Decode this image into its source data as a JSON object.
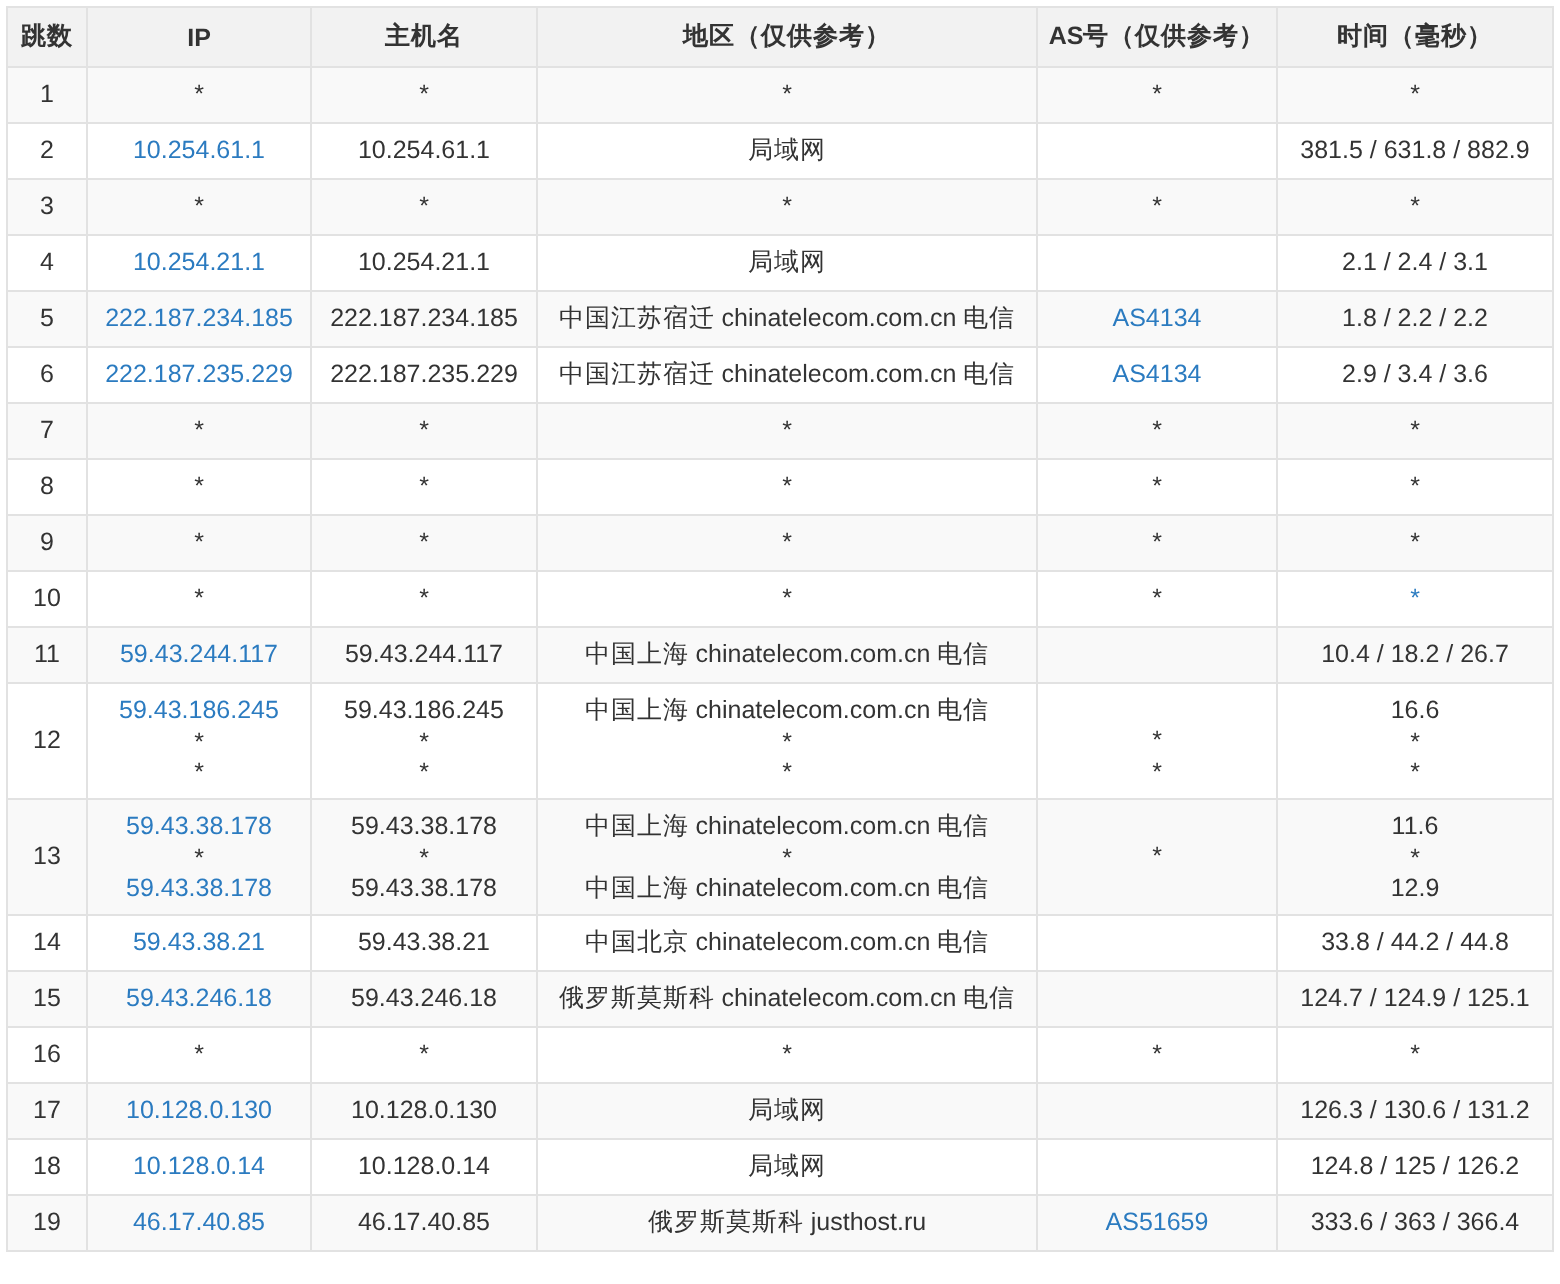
{
  "table": {
    "columns": [
      "跳数",
      "IP",
      "主机名",
      "地区（仅供参考）",
      "AS号（仅供参考）",
      "时间（毫秒）"
    ],
    "rows": [
      {
        "cells": [
          [
            {
              "text": "1",
              "link": false
            }
          ],
          [
            {
              "text": "*",
              "link": false
            }
          ],
          [
            {
              "text": "*",
              "link": false
            }
          ],
          [
            {
              "text": "*",
              "link": false
            }
          ],
          [
            {
              "text": "*",
              "link": false
            }
          ],
          [
            {
              "text": "*",
              "link": false
            }
          ]
        ]
      },
      {
        "cells": [
          [
            {
              "text": "2",
              "link": false
            }
          ],
          [
            {
              "text": "10.254.61.1",
              "link": true
            }
          ],
          [
            {
              "text": "10.254.61.1",
              "link": false
            }
          ],
          [
            {
              "text": "局域网",
              "link": false
            }
          ],
          [],
          [
            {
              "text": "381.5 / 631.8 / 882.9",
              "link": false
            }
          ]
        ]
      },
      {
        "cells": [
          [
            {
              "text": "3",
              "link": false
            }
          ],
          [
            {
              "text": "*",
              "link": false
            }
          ],
          [
            {
              "text": "*",
              "link": false
            }
          ],
          [
            {
              "text": "*",
              "link": false
            }
          ],
          [
            {
              "text": "*",
              "link": false
            }
          ],
          [
            {
              "text": "*",
              "link": false
            }
          ]
        ]
      },
      {
        "cells": [
          [
            {
              "text": "4",
              "link": false
            }
          ],
          [
            {
              "text": "10.254.21.1",
              "link": true
            }
          ],
          [
            {
              "text": "10.254.21.1",
              "link": false
            }
          ],
          [
            {
              "text": "局域网",
              "link": false
            }
          ],
          [],
          [
            {
              "text": "2.1 / 2.4 / 3.1",
              "link": false
            }
          ]
        ]
      },
      {
        "cells": [
          [
            {
              "text": "5",
              "link": false
            }
          ],
          [
            {
              "text": "222.187.234.185",
              "link": true
            }
          ],
          [
            {
              "text": "222.187.234.185",
              "link": false
            }
          ],
          [
            {
              "text": "中国江苏宿迁 chinatelecom.com.cn 电信",
              "link": false
            }
          ],
          [
            {
              "text": "AS4134",
              "link": true
            }
          ],
          [
            {
              "text": "1.8 / 2.2 / 2.2",
              "link": false
            }
          ]
        ]
      },
      {
        "cells": [
          [
            {
              "text": "6",
              "link": false
            }
          ],
          [
            {
              "text": "222.187.235.229",
              "link": true
            }
          ],
          [
            {
              "text": "222.187.235.229",
              "link": false
            }
          ],
          [
            {
              "text": "中国江苏宿迁 chinatelecom.com.cn 电信",
              "link": false
            }
          ],
          [
            {
              "text": "AS4134",
              "link": true
            }
          ],
          [
            {
              "text": "2.9 / 3.4 / 3.6",
              "link": false
            }
          ]
        ]
      },
      {
        "cells": [
          [
            {
              "text": "7",
              "link": false
            }
          ],
          [
            {
              "text": "*",
              "link": false
            }
          ],
          [
            {
              "text": "*",
              "link": false
            }
          ],
          [
            {
              "text": "*",
              "link": false
            }
          ],
          [
            {
              "text": "*",
              "link": false
            }
          ],
          [
            {
              "text": "*",
              "link": false
            }
          ]
        ]
      },
      {
        "cells": [
          [
            {
              "text": "8",
              "link": false
            }
          ],
          [
            {
              "text": "*",
              "link": false
            }
          ],
          [
            {
              "text": "*",
              "link": false
            }
          ],
          [
            {
              "text": "*",
              "link": false
            }
          ],
          [
            {
              "text": "*",
              "link": false
            }
          ],
          [
            {
              "text": "*",
              "link": false
            }
          ]
        ]
      },
      {
        "cells": [
          [
            {
              "text": "9",
              "link": false
            }
          ],
          [
            {
              "text": "*",
              "link": false
            }
          ],
          [
            {
              "text": "*",
              "link": false
            }
          ],
          [
            {
              "text": "*",
              "link": false
            }
          ],
          [
            {
              "text": "*",
              "link": false
            }
          ],
          [
            {
              "text": "*",
              "link": false
            }
          ]
        ]
      },
      {
        "cells": [
          [
            {
              "text": "10",
              "link": false
            }
          ],
          [
            {
              "text": "*",
              "link": false
            }
          ],
          [
            {
              "text": "*",
              "link": false
            }
          ],
          [
            {
              "text": "*",
              "link": false
            }
          ],
          [
            {
              "text": "*",
              "link": false
            }
          ],
          [
            {
              "text": "*",
              "link": true
            }
          ]
        ]
      },
      {
        "cells": [
          [
            {
              "text": "11",
              "link": false
            }
          ],
          [
            {
              "text": "59.43.244.117",
              "link": true
            }
          ],
          [
            {
              "text": "59.43.244.117",
              "link": false
            }
          ],
          [
            {
              "text": "中国上海 chinatelecom.com.cn 电信",
              "link": false
            }
          ],
          [],
          [
            {
              "text": "10.4 / 18.2 / 26.7",
              "link": false
            }
          ]
        ]
      },
      {
        "cells": [
          [
            {
              "text": "12",
              "link": false
            }
          ],
          [
            {
              "text": "59.43.186.245",
              "link": true
            },
            {
              "text": "*",
              "link": false
            },
            {
              "text": "*",
              "link": false
            }
          ],
          [
            {
              "text": "59.43.186.245",
              "link": false
            },
            {
              "text": "*",
              "link": false
            },
            {
              "text": "*",
              "link": false
            }
          ],
          [
            {
              "text": "中国上海 chinatelecom.com.cn 电信",
              "link": false
            },
            {
              "text": "*",
              "link": false
            },
            {
              "text": "*",
              "link": false
            }
          ],
          [
            {
              "text": "*",
              "link": false
            },
            {
              "text": "*",
              "link": false
            }
          ],
          [
            {
              "text": "16.6",
              "link": false
            },
            {
              "text": "*",
              "link": false
            },
            {
              "text": "*",
              "link": false
            }
          ]
        ]
      },
      {
        "cells": [
          [
            {
              "text": "13",
              "link": false
            }
          ],
          [
            {
              "text": "59.43.38.178",
              "link": true
            },
            {
              "text": "*",
              "link": false
            },
            {
              "text": "59.43.38.178",
              "link": true
            }
          ],
          [
            {
              "text": "59.43.38.178",
              "link": false
            },
            {
              "text": "*",
              "link": false
            },
            {
              "text": "59.43.38.178",
              "link": false
            }
          ],
          [
            {
              "text": "中国上海 chinatelecom.com.cn 电信",
              "link": false
            },
            {
              "text": "*",
              "link": false
            },
            {
              "text": "中国上海 chinatelecom.com.cn 电信",
              "link": false
            }
          ],
          [
            {
              "text": "*",
              "link": false
            }
          ],
          [
            {
              "text": "11.6",
              "link": false
            },
            {
              "text": "*",
              "link": false
            },
            {
              "text": "12.9",
              "link": false
            }
          ]
        ]
      },
      {
        "cells": [
          [
            {
              "text": "14",
              "link": false
            }
          ],
          [
            {
              "text": "59.43.38.21",
              "link": true
            }
          ],
          [
            {
              "text": "59.43.38.21",
              "link": false
            }
          ],
          [
            {
              "text": "中国北京 chinatelecom.com.cn 电信",
              "link": false
            }
          ],
          [],
          [
            {
              "text": "33.8 / 44.2 / 44.8",
              "link": false
            }
          ]
        ]
      },
      {
        "cells": [
          [
            {
              "text": "15",
              "link": false
            }
          ],
          [
            {
              "text": "59.43.246.18",
              "link": true
            }
          ],
          [
            {
              "text": "59.43.246.18",
              "link": false
            }
          ],
          [
            {
              "text": "俄罗斯莫斯科 chinatelecom.com.cn 电信",
              "link": false
            }
          ],
          [],
          [
            {
              "text": "124.7 / 124.9 / 125.1",
              "link": false
            }
          ]
        ]
      },
      {
        "cells": [
          [
            {
              "text": "16",
              "link": false
            }
          ],
          [
            {
              "text": "*",
              "link": false
            }
          ],
          [
            {
              "text": "*",
              "link": false
            }
          ],
          [
            {
              "text": "*",
              "link": false
            }
          ],
          [
            {
              "text": "*",
              "link": false
            }
          ],
          [
            {
              "text": "*",
              "link": false
            }
          ]
        ]
      },
      {
        "cells": [
          [
            {
              "text": "17",
              "link": false
            }
          ],
          [
            {
              "text": "10.128.0.130",
              "link": true
            }
          ],
          [
            {
              "text": "10.128.0.130",
              "link": false
            }
          ],
          [
            {
              "text": "局域网",
              "link": false
            }
          ],
          [],
          [
            {
              "text": "126.3 / 130.6 / 131.2",
              "link": false
            }
          ]
        ]
      },
      {
        "cells": [
          [
            {
              "text": "18",
              "link": false
            }
          ],
          [
            {
              "text": "10.128.0.14",
              "link": true
            }
          ],
          [
            {
              "text": "10.128.0.14",
              "link": false
            }
          ],
          [
            {
              "text": "局域网",
              "link": false
            }
          ],
          [],
          [
            {
              "text": "124.8 / 125 / 126.2",
              "link": false
            }
          ]
        ]
      },
      {
        "cells": [
          [
            {
              "text": "19",
              "link": false
            }
          ],
          [
            {
              "text": "46.17.40.85",
              "link": true
            }
          ],
          [
            {
              "text": "46.17.40.85",
              "link": false
            }
          ],
          [
            {
              "text": "俄罗斯莫斯科 justhost.ru",
              "link": false
            }
          ],
          [
            {
              "text": "AS51659",
              "link": true
            }
          ],
          [
            {
              "text": "333.6 / 363 / 366.4",
              "link": false
            }
          ]
        ]
      }
    ]
  }
}
